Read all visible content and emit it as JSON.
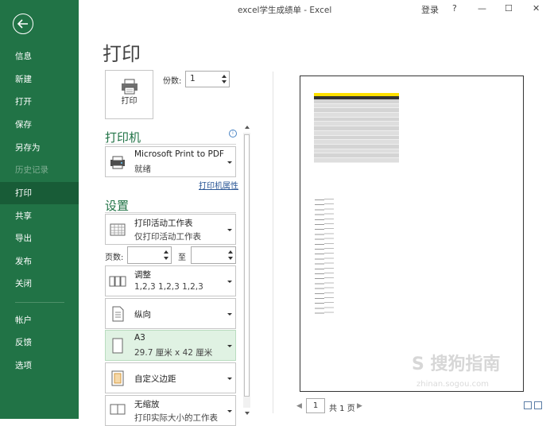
{
  "window": {
    "title": "excel学生成绩单  -  Excel",
    "signin": "登录",
    "help": "?",
    "minimize": "—",
    "maximize": "☐",
    "close": "✕"
  },
  "sidebar": {
    "items": [
      {
        "label": "信息"
      },
      {
        "label": "新建"
      },
      {
        "label": "打开"
      },
      {
        "label": "保存"
      },
      {
        "label": "另存为"
      },
      {
        "label": "历史记录"
      },
      {
        "label": "打印"
      },
      {
        "label": "共享"
      },
      {
        "label": "导出"
      },
      {
        "label": "发布"
      },
      {
        "label": "关闭"
      },
      {
        "label": "帐户"
      },
      {
        "label": "反馈"
      },
      {
        "label": "选项"
      }
    ]
  },
  "print": {
    "title": "打印",
    "button_label": "打印",
    "copies_label": "份数:",
    "copies_value": "1"
  },
  "printer": {
    "heading": "打印机",
    "name": "Microsoft Print to PDF",
    "status": "就绪",
    "properties_link": "打印机属性"
  },
  "settings": {
    "heading": "设置",
    "what": {
      "line1": "打印活动工作表",
      "line2": "仅打印活动工作表"
    },
    "pages_label": "页数:",
    "to_label": "至",
    "collate": {
      "line1": "调整",
      "line2": "1,2,3    1,2,3    1,2,3"
    },
    "orientation": {
      "line1": "纵向"
    },
    "paper": {
      "line1": "A3",
      "line2": "29.7 厘米 x 42 厘米"
    },
    "margins": {
      "line1": "自定义边距"
    },
    "scaling": {
      "line1": "无缩放",
      "line2": "打印实际大小的工作表"
    }
  },
  "pager": {
    "current": "1",
    "total": "共 1 页"
  },
  "watermark": {
    "text": "S 搜狗指南",
    "url": "zhinan.sogou.com"
  }
}
